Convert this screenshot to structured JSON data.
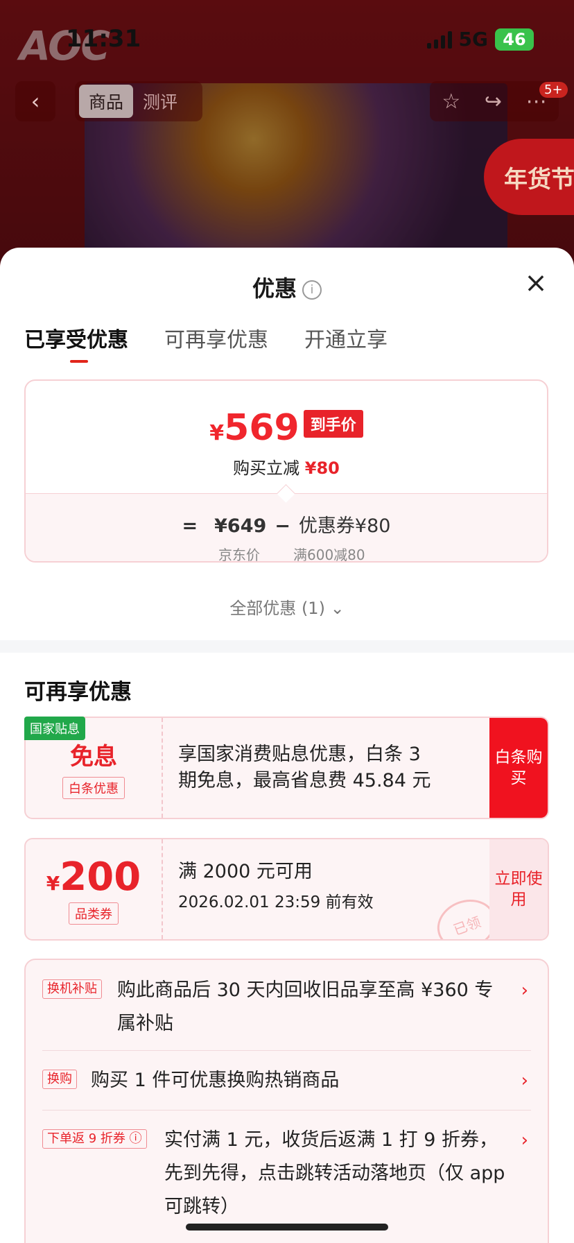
{
  "status_bar": {
    "time": "11:31",
    "network": "5G",
    "battery": "46"
  },
  "backdrop": {
    "logo": "AOC",
    "segment_tabs": [
      "商品",
      "测评"
    ],
    "badge": "5+",
    "festival": "年货节"
  },
  "sheet": {
    "title": "优惠",
    "close_icon": "×",
    "tabs": [
      "已享受优惠",
      "可再享优惠",
      "开通立享"
    ],
    "price_card": {
      "currency": "¥",
      "final_price": "569",
      "final_price_tag": "到手价",
      "reduce_label": "购买立减",
      "reduce_amount": "¥80",
      "equals": "=",
      "jd_price": "¥649",
      "minus": "−",
      "coupon_label": "优惠券¥80",
      "jd_price_label": "京东价",
      "coupon_rule": "满600减80"
    },
    "all_offers": "全部优惠 (1)",
    "section_title": "可再享优惠",
    "coupon1": {
      "corner_tag": "国家贴息",
      "main": "免息",
      "sub": "白条优惠",
      "desc": "享国家消费贴息优惠，白条 3 期免息，最高省息费 45.84 元",
      "action": "白条购买"
    },
    "coupon2": {
      "currency": "¥",
      "amount": "200",
      "sub": "品类券",
      "line1": "满 2000 元可用",
      "line2": "2026.02.01 23:59 前有效",
      "action": "立即使用",
      "stamp": "已领"
    },
    "promos": [
      {
        "tag": "换机补贴",
        "text": "购此商品后 30 天内回收旧品享至高 ¥360 专属补贴"
      },
      {
        "tag": "换购",
        "text": "购买 1 件可优惠换购热销商品"
      },
      {
        "tag": "下单返 9 折券 ⓘ",
        "text": "实付满 1 元，收货后返满 1 打 9 折券，先到先得，点击跳转活动落地页（仅 app 可跳转）"
      }
    ]
  }
}
